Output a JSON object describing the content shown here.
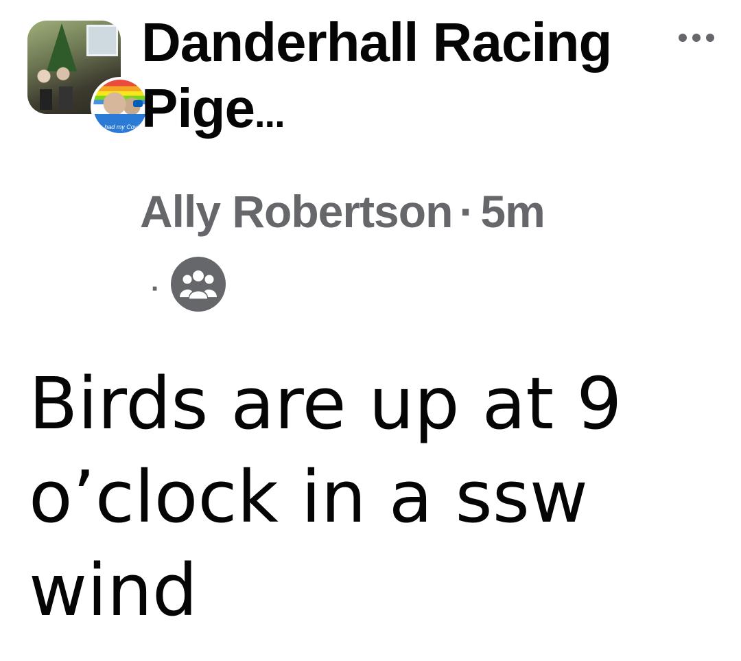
{
  "post": {
    "group_name": "Danderhall Racing Pige",
    "group_name_ellipsis": "...",
    "author": "Ally Robertson",
    "separator": "·",
    "timestamp": "5m",
    "privacy_separator": "·",
    "privacy_icon": "group-icon",
    "avatar_badge_text": "I've had my Covid vaccine",
    "body_text": "Birds are up at 9 o’clock in a ssw wind"
  },
  "colors": {
    "primary_text": "#050505",
    "secondary_text": "#65676b",
    "background": "#ffffff"
  },
  "icons": {
    "more": "more-horizontal-icon",
    "privacy": "group-icon"
  }
}
